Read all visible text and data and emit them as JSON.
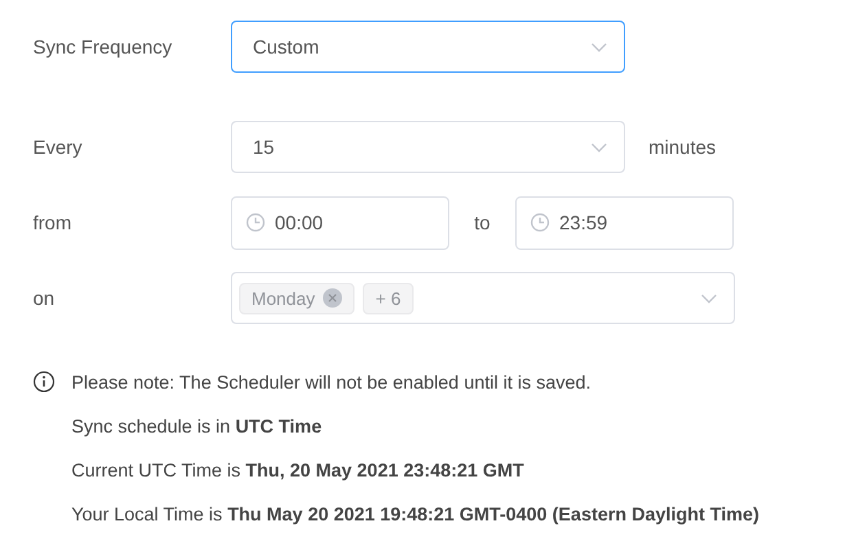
{
  "frequency": {
    "label": "Sync Frequency",
    "value": "Custom",
    "focused": true
  },
  "every": {
    "label": "Every",
    "value": "15",
    "focused": false,
    "unit": "minutes"
  },
  "range": {
    "label": "from",
    "start": "00:00",
    "separator": "to",
    "end": "23:59"
  },
  "days": {
    "label": "on",
    "tags": [
      {
        "text": "Monday",
        "removable": true
      },
      {
        "text": "+ 6",
        "removable": false
      }
    ]
  },
  "notes": [
    {
      "kind": "info",
      "text": "Please note: The Scheduler will not be enabled until it is saved."
    },
    {
      "kind": "plain",
      "text": "Sync schedule is in **UTC Time**"
    },
    {
      "kind": "plain",
      "text": "Current UTC Time is **Thu, 20 May 2021 23:48:21 GMT**"
    },
    {
      "kind": "plain",
      "text": "Your Local Time is **Thu May 20 2021 19:48:21 GMT-0400 (Eastern Daylight Time)**"
    }
  ]
}
